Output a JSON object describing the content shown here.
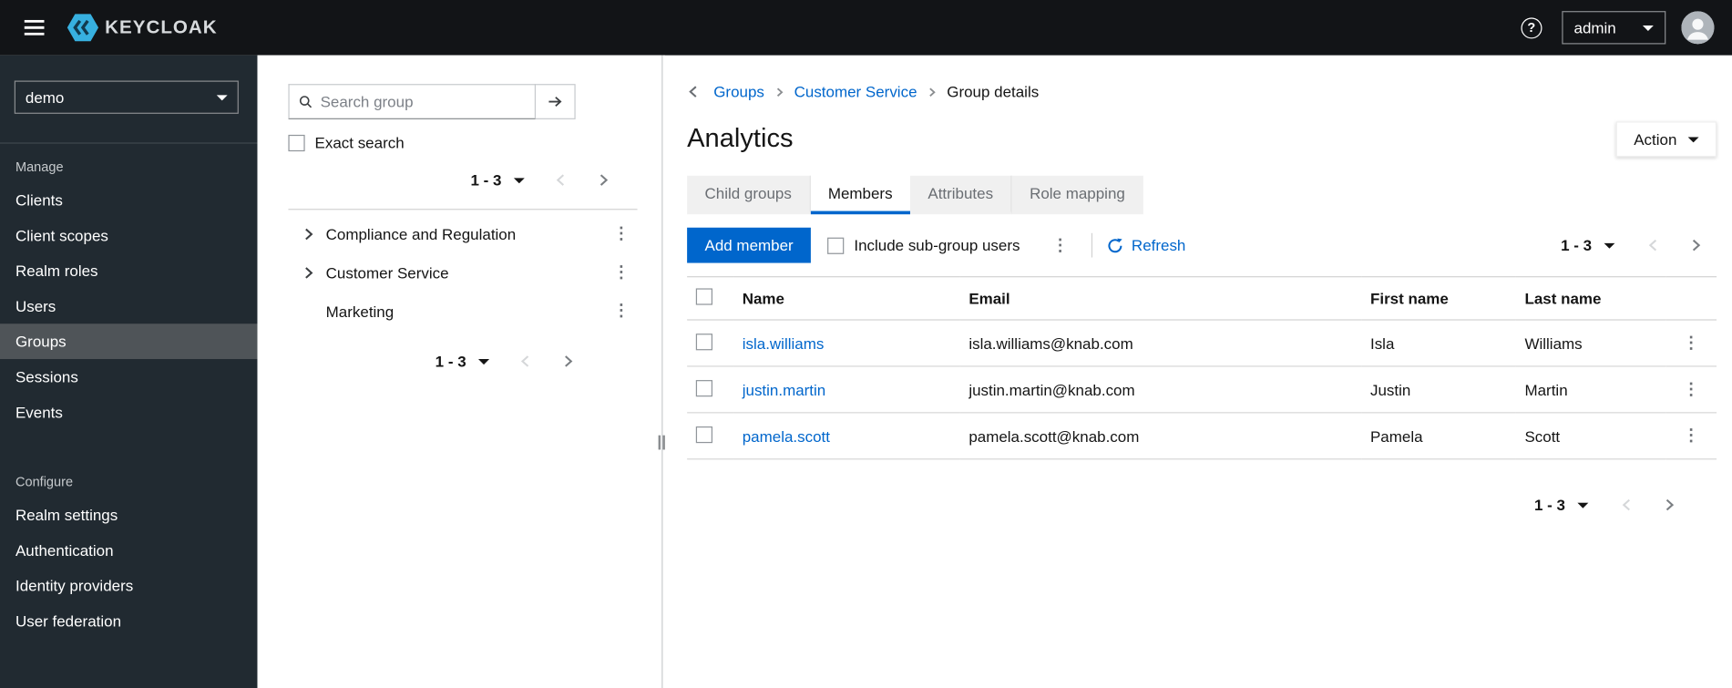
{
  "icons": {
    "help": "?",
    "kebab": "⋮"
  },
  "masthead": {
    "brand": "KEYCLOAK",
    "username": "admin"
  },
  "sidebar": {
    "realm": "demo",
    "selected_item": "Groups",
    "sections": [
      {
        "label": "Manage",
        "items": [
          "Clients",
          "Client scopes",
          "Realm roles",
          "Users",
          "Groups",
          "Sessions",
          "Events"
        ]
      },
      {
        "label": "Configure",
        "items": [
          "Realm settings",
          "Authentication",
          "Identity providers",
          "User federation"
        ]
      }
    ]
  },
  "groups_panel": {
    "search_placeholder": "Search group",
    "exact_search_label": "Exact search",
    "pagination": {
      "range": "1 - 3"
    },
    "pagination_bottom": {
      "range": "1 - 3"
    },
    "tree": [
      {
        "label": "Compliance and Regulation",
        "expandable": true
      },
      {
        "label": "Customer Service",
        "expandable": true
      },
      {
        "label": "Marketing",
        "expandable": false
      }
    ]
  },
  "main": {
    "breadcrumb": {
      "items": [
        "Groups",
        "Customer Service",
        "Group details"
      ]
    },
    "title": "Analytics",
    "action_button": "Action",
    "tabs": [
      {
        "label": "Child groups",
        "active": false
      },
      {
        "label": "Members",
        "active": true
      },
      {
        "label": "Attributes",
        "active": false
      },
      {
        "label": "Role mapping",
        "active": false
      }
    ],
    "toolbar": {
      "add_member_label": "Add member",
      "include_subgroups_label": "Include sub-group users",
      "refresh_label": "Refresh",
      "pagination": {
        "range": "1 - 3"
      }
    },
    "members_table": {
      "headers": {
        "name": "Name",
        "email": "Email",
        "first_name": "First name",
        "last_name": "Last name"
      },
      "rows": [
        {
          "name": "isla.williams",
          "email": "isla.williams@knab.com",
          "first_name": "Isla",
          "last_name": "Williams"
        },
        {
          "name": "justin.martin",
          "email": "justin.martin@knab.com",
          "first_name": "Justin",
          "last_name": "Martin"
        },
        {
          "name": "pamela.scott",
          "email": "pamela.scott@knab.com",
          "first_name": "Pamela",
          "last_name": "Scott"
        }
      ]
    },
    "pagination_bottom": {
      "range": "1 - 3"
    }
  },
  "colors": {
    "primary": "#0066cc",
    "link": "#0066cc",
    "masthead_bg": "#121417",
    "sidebar_bg": "#212a31",
    "sidebar_selected_bg": "#4f5458",
    "active_tab_underline": "#0066cc"
  }
}
